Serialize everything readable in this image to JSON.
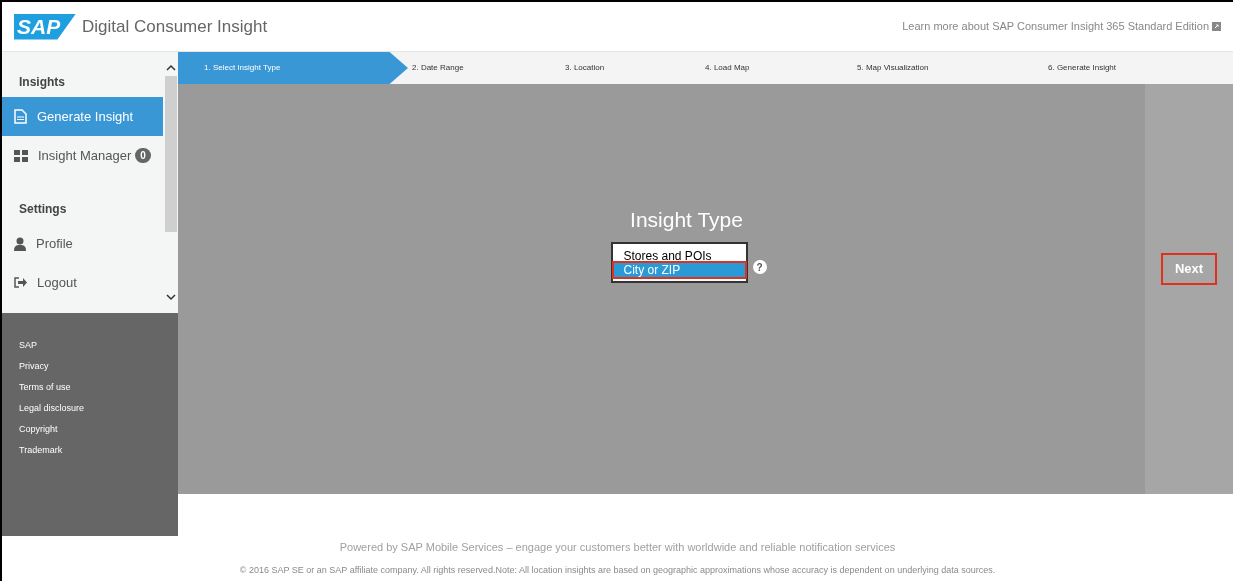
{
  "header": {
    "logo": "SAP",
    "title": "Digital Consumer Insight",
    "link": "Learn more about SAP Consumer Insight 365 Standard Edition"
  },
  "sidebar": {
    "sections": [
      {
        "heading": "Insights",
        "items": [
          {
            "label": "Generate Insight",
            "kind": "document",
            "selected": true
          },
          {
            "label": "Insight Manager",
            "kind": "grid",
            "badge": "0",
            "selected": false
          }
        ]
      },
      {
        "heading": "Settings",
        "items": [
          {
            "label": "Profile",
            "kind": "user",
            "selected": false
          },
          {
            "label": "Logout",
            "kind": "logout",
            "selected": false
          }
        ]
      }
    ],
    "links": [
      "SAP",
      "Privacy",
      "Terms of use",
      "Legal disclosure",
      "Copyright",
      "Trademark"
    ]
  },
  "steps": [
    {
      "label": "1. Select Insight Type",
      "selected": true
    },
    {
      "label": "2. Date Range",
      "selected": false
    },
    {
      "label": "3. Location",
      "selected": false
    },
    {
      "label": "4. Load Map",
      "selected": false
    },
    {
      "label": "5. Map Visualization",
      "selected": false
    },
    {
      "label": "6. Generate Insight",
      "selected": false
    }
  ],
  "panel": {
    "title": "Insight Type",
    "options": [
      {
        "label": "Stores and POIs",
        "selected": false
      },
      {
        "label": "City or ZIP",
        "selected": true
      }
    ],
    "help": "?",
    "next": "Next"
  },
  "footer": {
    "powered": "Powered by SAP Mobile Services – engage your customers better with worldwide and reliable notification services",
    "legal": "© 2016 SAP SE or an SAP affiliate company. All rights reserved.Note: All location insights are based on geographic approximations whose accuracy is dependent on underlying data sources."
  }
}
